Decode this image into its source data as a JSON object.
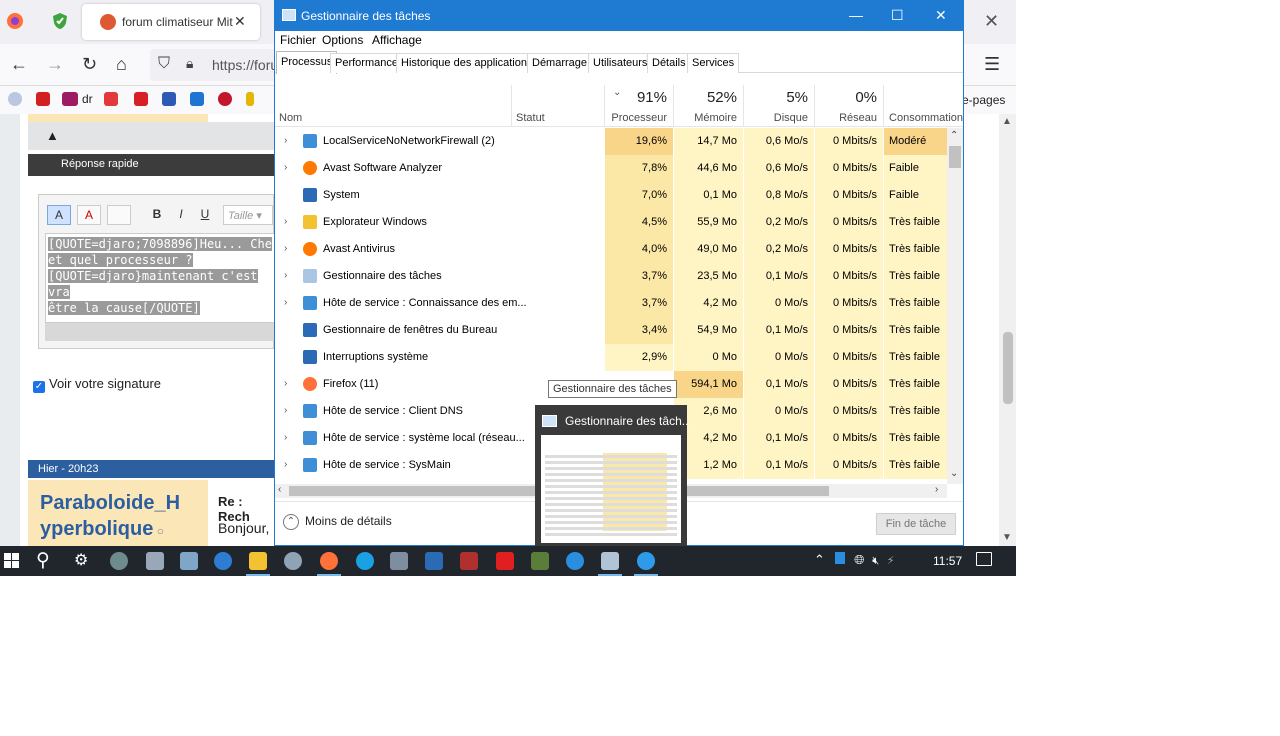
{
  "firefox": {
    "tab_title": "forum climatiseur Mit",
    "url": "https://foru",
    "bookmark_dr": "dr",
    "bookmark_pages": "e-pages"
  },
  "forum": {
    "quick_reply": "Réponse rapide",
    "size_placeholder": "Taille",
    "editor_lines": [
      "[QUOTE=djaro;7098896]Heu... Che",
      "et quel processeur ?",
      "[QUOTE=djaro}maintenant c'est vra",
      "être la cause[/QUOTE]"
    ],
    "signature_label": "Voir votre signature",
    "post_date": "Hier - 20h23",
    "post_author_line1": "Paraboloide_H",
    "post_author_line2": "yperbolique",
    "post_title": "Re : Rech",
    "post_text": "Bonjour,"
  },
  "taskmgr": {
    "title": "Gestionnaire des tâches",
    "menu": [
      "Fichier",
      "Options",
      "Affichage"
    ],
    "tabs": [
      "Processus",
      "Performance",
      "Historique des applications",
      "Démarrage",
      "Utilisateurs",
      "Détails",
      "Services"
    ],
    "header": {
      "name": "Nom",
      "status": "Statut",
      "cpu_pct": "91%",
      "cpu_label": "Processeur",
      "mem_pct": "52%",
      "mem_label": "Mémoire",
      "disk_pct": "5%",
      "disk_label": "Disque",
      "net_pct": "0%",
      "net_label": "Réseau",
      "power_label": "Consommation"
    },
    "rows": [
      {
        "name": "LocalServiceNoNetworkFirewall (2)",
        "cpu": "19,6%",
        "mem": "14,7 Mo",
        "disk": "0,6 Mo/s",
        "net": "0 Mbits/s",
        "power": "Modéré",
        "expand": true,
        "icon": "gear-icon"
      },
      {
        "name": "Avast Software Analyzer",
        "cpu": "7,8%",
        "mem": "44,6 Mo",
        "disk": "0,6 Mo/s",
        "net": "0 Mbits/s",
        "power": "Faible",
        "expand": true,
        "icon": "avast-icon"
      },
      {
        "name": "System",
        "cpu": "7,0%",
        "mem": "0,1 Mo",
        "disk": "0,8 Mo/s",
        "net": "0 Mbits/s",
        "power": "Faible",
        "expand": false,
        "icon": "system-icon"
      },
      {
        "name": "Explorateur Windows",
        "cpu": "4,5%",
        "mem": "55,9 Mo",
        "disk": "0,2 Mo/s",
        "net": "0 Mbits/s",
        "power": "Très faible",
        "expand": true,
        "icon": "folder-icon"
      },
      {
        "name": "Avast Antivirus",
        "cpu": "4,0%",
        "mem": "49,0 Mo",
        "disk": "0,2 Mo/s",
        "net": "0 Mbits/s",
        "power": "Très faible",
        "expand": true,
        "icon": "avast-icon"
      },
      {
        "name": "Gestionnaire des tâches",
        "cpu": "3,7%",
        "mem": "23,5 Mo",
        "disk": "0,1 Mo/s",
        "net": "0 Mbits/s",
        "power": "Très faible",
        "expand": true,
        "icon": "taskmgr-icon"
      },
      {
        "name": "Hôte de service : Connaissance des em...",
        "cpu": "3,7%",
        "mem": "4,2 Mo",
        "disk": "0 Mo/s",
        "net": "0 Mbits/s",
        "power": "Très faible",
        "expand": true,
        "icon": "gear-icon"
      },
      {
        "name": "Gestionnaire de fenêtres du Bureau",
        "cpu": "3,4%",
        "mem": "54,9 Mo",
        "disk": "0,1 Mo/s",
        "net": "0 Mbits/s",
        "power": "Très faible",
        "expand": false,
        "icon": "system-icon"
      },
      {
        "name": "Interruptions système",
        "cpu": "2,9%",
        "mem": "0 Mo",
        "disk": "0 Mo/s",
        "net": "0 Mbits/s",
        "power": "Très faible",
        "expand": false,
        "icon": "system-icon"
      },
      {
        "name": "Firefox (11)",
        "cpu": "",
        "mem": "594,1 Mo",
        "disk": "0,1 Mo/s",
        "net": "0 Mbits/s",
        "power": "Très faible",
        "expand": true,
        "icon": "firefox-icon"
      },
      {
        "name": "Hôte de service : Client DNS",
        "cpu": "",
        "mem": "2,6 Mo",
        "disk": "0 Mo/s",
        "net": "0 Mbits/s",
        "power": "Très faible",
        "expand": true,
        "icon": "gear-icon"
      },
      {
        "name": "Hôte de service : système local (réseau...",
        "cpu": "",
        "mem": "4,2 Mo",
        "disk": "0,1 Mo/s",
        "net": "0 Mbits/s",
        "power": "Très faible",
        "expand": true,
        "icon": "gear-icon"
      },
      {
        "name": "Hôte de service : SysMain",
        "cpu": "",
        "mem": "1,2 Mo",
        "disk": "0,1 Mo/s",
        "net": "0 Mbits/s",
        "power": "Très faible",
        "expand": true,
        "icon": "gear-icon"
      }
    ],
    "less_details": "Moins de détails",
    "end_task": "Fin de tâche"
  },
  "tooltip": "Gestionnaire des tâches",
  "thumbnail_title": "Gestionnaire des tâch...",
  "clock": "11:57",
  "colors": {
    "titlebar": "#1f7ad1",
    "heat_strong": "#f9d58a",
    "heat_medium": "#fbe8a6",
    "heat_light": "#fff4c4",
    "taskbar": "#20262c"
  }
}
